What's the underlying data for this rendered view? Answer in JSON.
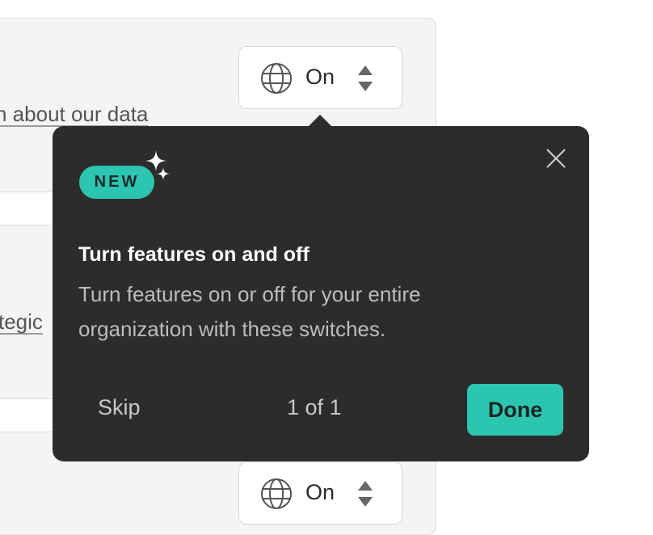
{
  "background": {
    "select_top": {
      "value": "On",
      "icon": "globe-icon"
    },
    "select_bottom": {
      "value": "On",
      "icon": "globe-icon"
    },
    "link_1": "n about our data",
    "link_2": "tegic"
  },
  "popover": {
    "badge": "NEW",
    "title": "Turn features on and off",
    "description": "Turn features on or off for your entire organization with these switches.",
    "skip_label": "Skip",
    "counter": "1 of 1",
    "done_label": "Done",
    "close_icon": "close-icon"
  },
  "colors": {
    "popover_bg": "#2c2c2c",
    "accent": "#2cc5b0",
    "panel_bg": "#f4f4f4"
  }
}
